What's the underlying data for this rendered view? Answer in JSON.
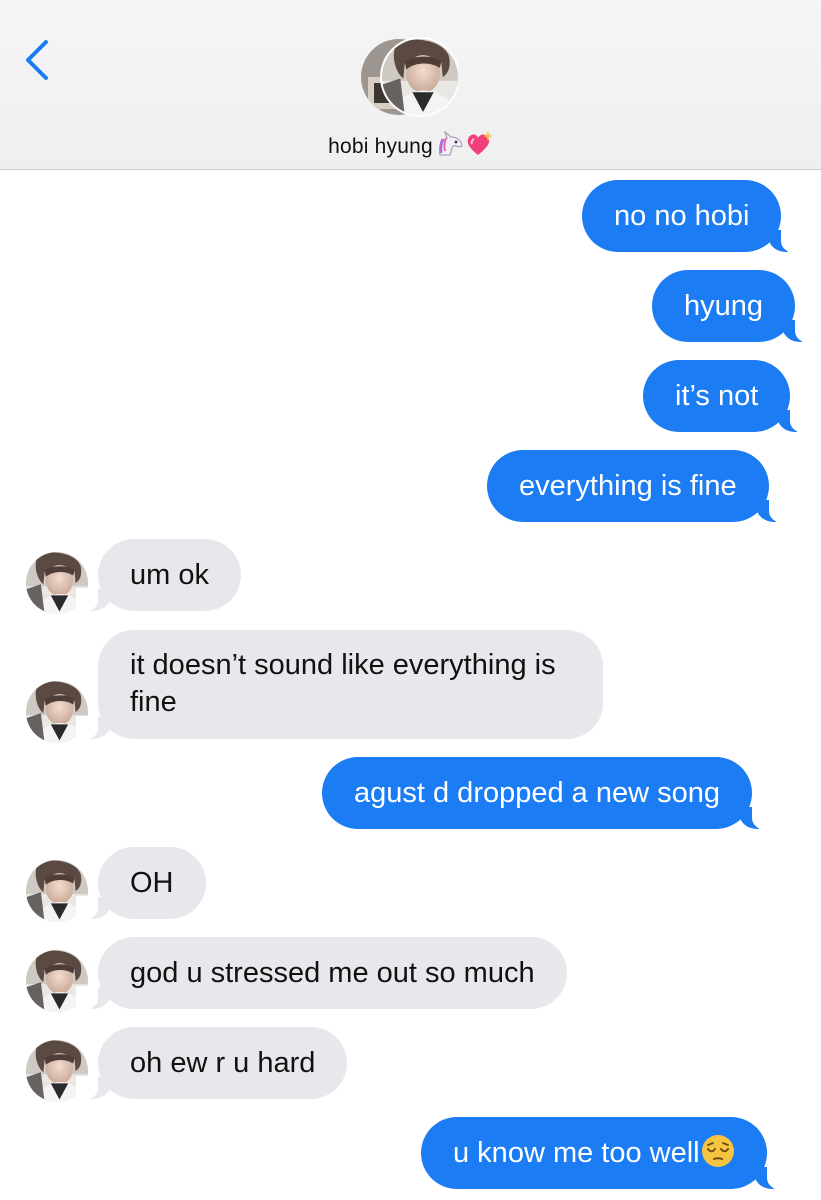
{
  "header": {
    "back_icon": "chevron-left-icon",
    "contact_name": "hobi hyung",
    "contact_emoji": [
      "unicorn-emoji",
      "sparkling-heart-emoji"
    ],
    "accent_color": "#1b7cf4"
  },
  "messages": [
    {
      "from": "me",
      "text": "no no hobi"
    },
    {
      "from": "me",
      "text": "hyung"
    },
    {
      "from": "me",
      "text": "it’s not"
    },
    {
      "from": "me",
      "text": "everything is fine"
    },
    {
      "from": "them",
      "text": "um ok"
    },
    {
      "from": "them",
      "text": "it doesn’t sound like everything is fine"
    },
    {
      "from": "me",
      "text": "agust d dropped a new song"
    },
    {
      "from": "them",
      "text": "OH"
    },
    {
      "from": "them",
      "text": "god u stressed me out so much"
    },
    {
      "from": "them",
      "text": "oh ew r u hard"
    },
    {
      "from": "me",
      "text": "u know me too well",
      "emoji": "pensive-face-emoji"
    }
  ],
  "colors": {
    "outgoing": "#1b7cf4",
    "incoming": "#e8e8ec"
  }
}
